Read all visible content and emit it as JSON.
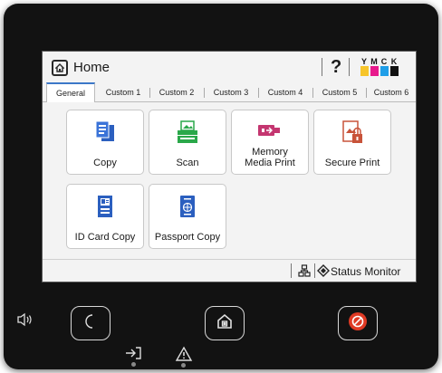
{
  "header": {
    "title": "Home",
    "help_label": "?"
  },
  "ink_levels": [
    {
      "label": "Y",
      "color": "#f7c52a"
    },
    {
      "label": "M",
      "color": "#e8198c"
    },
    {
      "label": "C",
      "color": "#1f9ee8"
    },
    {
      "label": "K",
      "color": "#111111"
    }
  ],
  "tabs": [
    "General",
    "Custom 1",
    "Custom 2",
    "Custom 3",
    "Custom 4",
    "Custom 5",
    "Custom 6"
  ],
  "tiles": {
    "copy": "Copy",
    "scan": "Scan",
    "memory_line1": "Memory",
    "memory_line2": "Media Print",
    "secure_print": "Secure Print",
    "id_card_copy": "ID Card Copy",
    "passport_copy": "Passport Copy"
  },
  "status": {
    "monitor_label": "Status Monitor"
  },
  "hardware": {
    "speaker": "speaker-icon",
    "sleep": "moon-icon",
    "home": "home-icon",
    "stop": "stop-icon",
    "data": "data-arrow-icon",
    "error": "warning-icon"
  },
  "colors": {
    "accent": "#e03a24",
    "tab_accent": "#3c78c8"
  }
}
